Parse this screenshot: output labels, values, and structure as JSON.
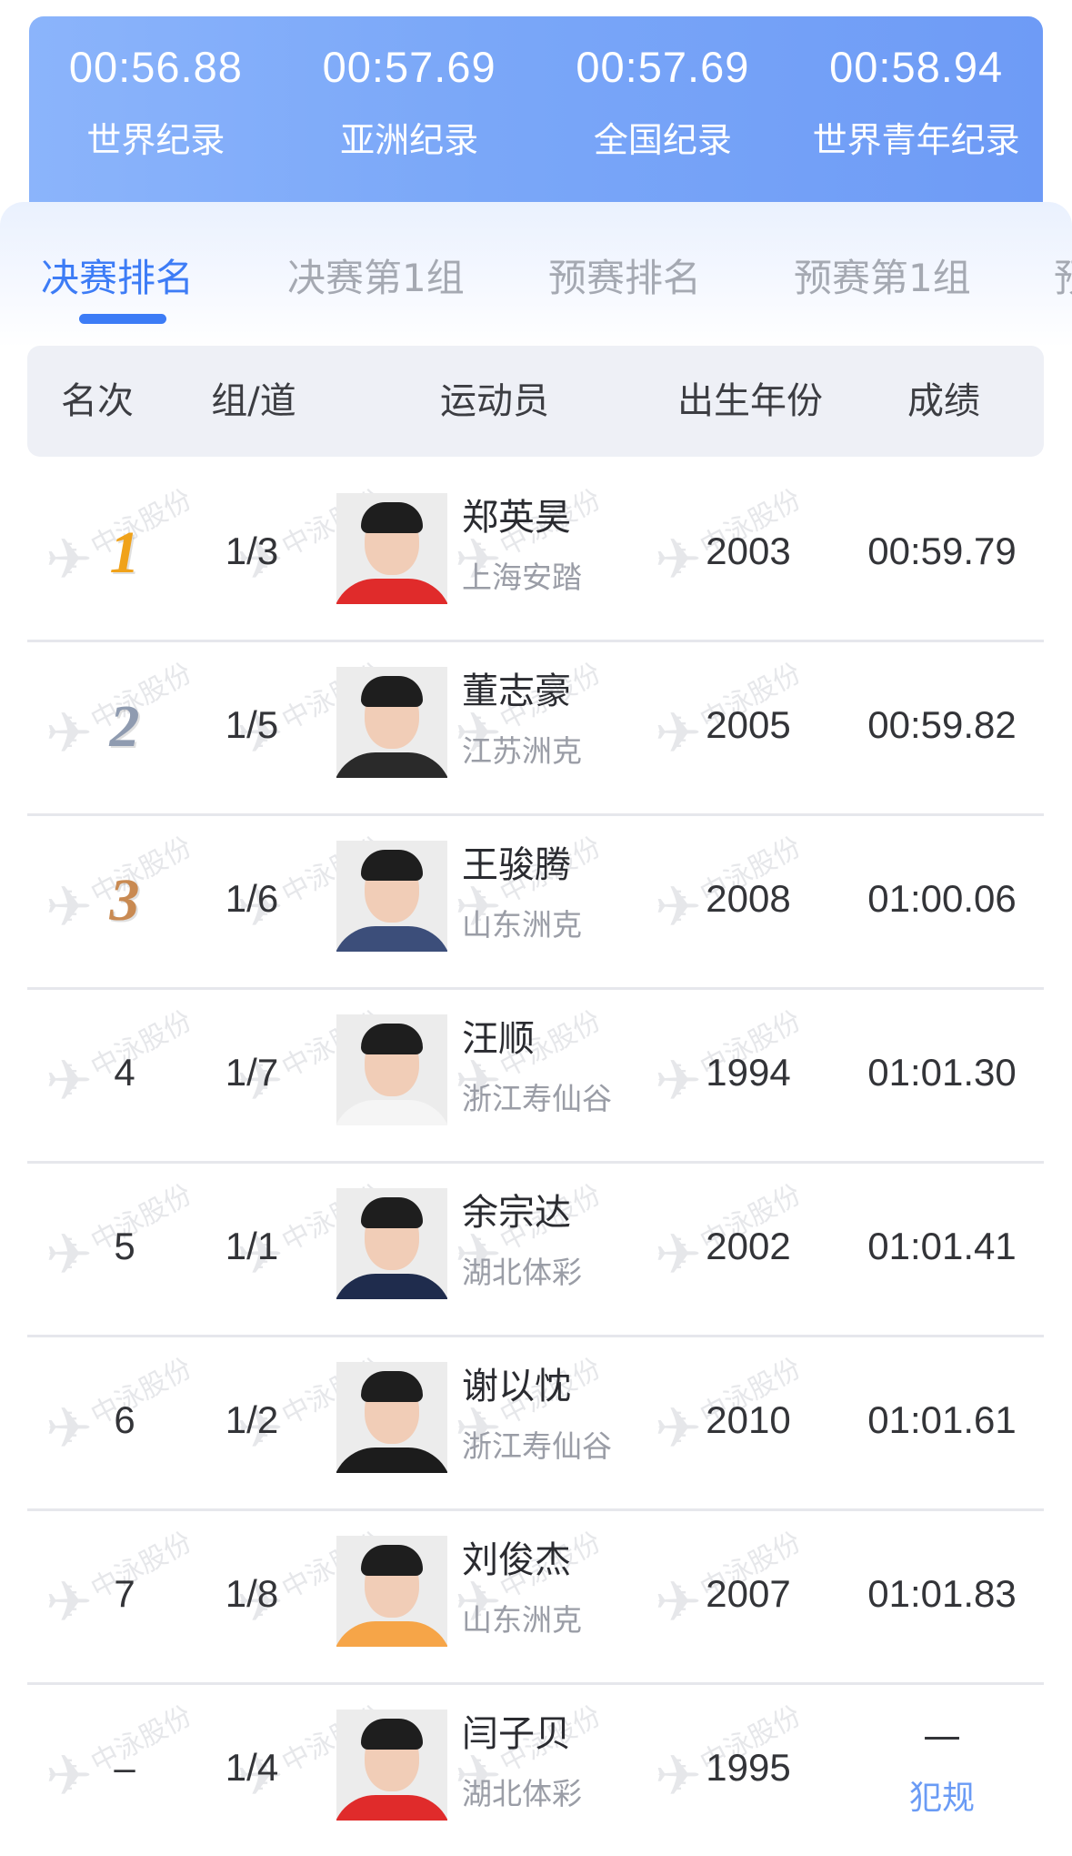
{
  "records": [
    {
      "time": "00:56.88",
      "label": "世界纪录"
    },
    {
      "time": "00:57.69",
      "label": "亚洲纪录"
    },
    {
      "time": "00:57.69",
      "label": "全国纪录"
    },
    {
      "time": "00:58.94",
      "label": "世界青年纪录"
    }
  ],
  "tabs": [
    {
      "label": "决赛排名",
      "active": true
    },
    {
      "label": "决赛第1组",
      "active": false
    },
    {
      "label": "预赛排名",
      "active": false
    },
    {
      "label": "预赛第1组",
      "active": false
    },
    {
      "label": "预",
      "active": false
    }
  ],
  "table": {
    "headers": {
      "rank": "名次",
      "lane": "组/道",
      "athlete": "运动员",
      "birth_year": "出生年份",
      "result": "成绩"
    },
    "rows": [
      {
        "rank": "1",
        "lane": "1/3",
        "name": "郑英昊",
        "team": "上海安踏",
        "year": "2003",
        "result": "00:59.79",
        "medal": "gold",
        "shirt": "#e02b2b"
      },
      {
        "rank": "2",
        "lane": "1/5",
        "name": "董志豪",
        "team": "江苏洲克",
        "year": "2005",
        "result": "00:59.82",
        "medal": "silver",
        "shirt": "#2a2a2a"
      },
      {
        "rank": "3",
        "lane": "1/6",
        "name": "王骏腾",
        "team": "山东洲克",
        "year": "2008",
        "result": "01:00.06",
        "medal": "bronze",
        "shirt": "#3c4e7a"
      },
      {
        "rank": "4",
        "lane": "1/7",
        "name": "汪顺",
        "team": "浙江寿仙谷",
        "year": "1994",
        "result": "01:01.30",
        "medal": "",
        "shirt": "#f5f5f5"
      },
      {
        "rank": "5",
        "lane": "1/1",
        "name": "余宗达",
        "team": "湖北体彩",
        "year": "2002",
        "result": "01:01.41",
        "medal": "",
        "shirt": "#1f2c4d"
      },
      {
        "rank": "6",
        "lane": "1/2",
        "name": "谢以忱",
        "team": "浙江寿仙谷",
        "year": "2010",
        "result": "01:01.61",
        "medal": "",
        "shirt": "#1c1c1c"
      },
      {
        "rank": "7",
        "lane": "1/8",
        "name": "刘俊杰",
        "team": "山东洲克",
        "year": "2007",
        "result": "01:01.83",
        "medal": "",
        "shirt": "#f6a548"
      },
      {
        "rank": "–",
        "lane": "1/4",
        "name": "闫子贝",
        "team": "湖北体彩",
        "year": "1995",
        "result": "—",
        "result_note": "犯规",
        "medal": "",
        "shirt": "#e02b2b"
      }
    ]
  },
  "watermark": "中泳股份",
  "colors": {
    "accent": "#3d7cf6",
    "gold": "#f0a21a",
    "silver": "#8f9bb0",
    "bronze": "#c98a52"
  }
}
